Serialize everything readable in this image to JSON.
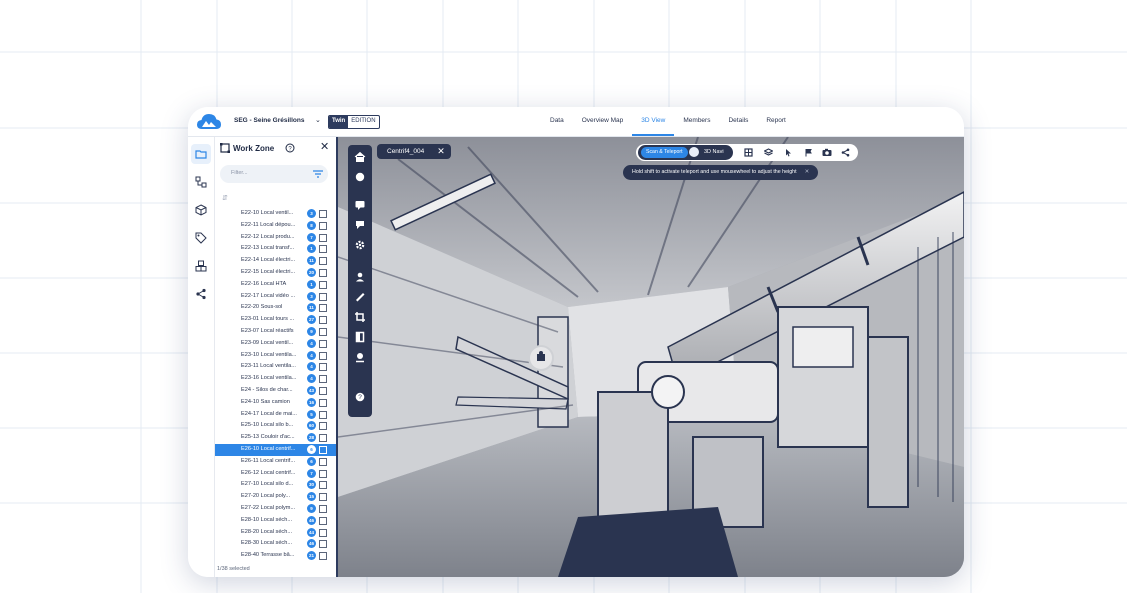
{
  "app": {
    "project_name": "SEG - Seine Grésillons",
    "edition_badge": "Twin",
    "edition_label": "EDITION",
    "colors": {
      "accent": "#2d86e6",
      "navy": "#2a3450",
      "panel_border": "#2d3b5e"
    }
  },
  "nav": {
    "tabs": [
      {
        "label": "Data",
        "active": false
      },
      {
        "label": "Overview Map",
        "active": false
      },
      {
        "label": "3D View",
        "active": true
      },
      {
        "label": "Members",
        "active": false
      },
      {
        "label": "Details",
        "active": false
      },
      {
        "label": "Report",
        "active": false
      }
    ]
  },
  "sidebar": {
    "icons": [
      "folder-icon",
      "hierarchy-icon",
      "cube-icon",
      "tag-icon",
      "cubes-icon",
      "share-icon"
    ],
    "active_index": 0
  },
  "work_zone": {
    "title": "Work Zone",
    "filter_placeholder": "Filter...",
    "items": [
      {
        "label": "E22-10 Local ventil...",
        "count": "3"
      },
      {
        "label": "E22-11 Local dépou...",
        "count": "8"
      },
      {
        "label": "E22-12 Local produ...",
        "count": "7"
      },
      {
        "label": "E22-13 Local transf...",
        "count": "1"
      },
      {
        "label": "E22-14 Local électri...",
        "count": "11"
      },
      {
        "label": "E22-15 Local électri...",
        "count": "20"
      },
      {
        "label": "E22-16 Local HTA",
        "count": "1"
      },
      {
        "label": "E22-17 Local vidéo ...",
        "count": "3"
      },
      {
        "label": "E22-20 Sous-sol",
        "count": "11"
      },
      {
        "label": "E23-01 Local tours ...",
        "count": "27"
      },
      {
        "label": "E23-07 Local réactifs",
        "count": "9"
      },
      {
        "label": "E23-09 Local ventil...",
        "count": "4"
      },
      {
        "label": "E23-10 Local ventila...",
        "count": "4"
      },
      {
        "label": "E23-11 Local ventila...",
        "count": "4"
      },
      {
        "label": "E23-16 Local ventila...",
        "count": "4"
      },
      {
        "label": "E24 - Silos de char...",
        "count": "43"
      },
      {
        "label": "E24-10 Sas camion",
        "count": "16"
      },
      {
        "label": "E24-17 Local de mai...",
        "count": "5"
      },
      {
        "label": "E25-10 Local silo b...",
        "count": "60"
      },
      {
        "label": "E25-13 Couloir d'ac...",
        "count": "28"
      },
      {
        "label": "E26-10 Local centrif...",
        "count": "6",
        "selected": true
      },
      {
        "label": "E26-11 Local centrif...",
        "count": "6"
      },
      {
        "label": "E26-12 Local centrif...",
        "count": "7"
      },
      {
        "label": "E27-10 Local silo d...",
        "count": "30"
      },
      {
        "label": "E27-20 Local poly...",
        "count": "15"
      },
      {
        "label": "E27-22 Local polym...",
        "count": "9"
      },
      {
        "label": "E28-10 Local séch...",
        "count": "46"
      },
      {
        "label": "E28-20 Local séch...",
        "count": "44"
      },
      {
        "label": "E28-30 Local séch...",
        "count": "46"
      },
      {
        "label": "E28-40 Terrasse bâ...",
        "count": "21"
      }
    ],
    "footer": "1/38 selected"
  },
  "viewer": {
    "scan_tab": "Centrif4_004",
    "mode_scan": "Scan & Teleport",
    "mode_nav": "3D Navi",
    "hint": "Hold shift to activate teleport and use mousewheel to adjust the height",
    "left_tools": [
      "home-icon",
      "sphere-icon",
      "comment-icon",
      "marker-icon",
      "gear-icon",
      "person-pin-icon",
      "ruler-icon",
      "crop-icon",
      "door-icon",
      "pin-icon",
      "help-icon"
    ],
    "top_tools": [
      "grid-icon",
      "layers-icon",
      "cursor-icon",
      "flag-icon",
      "camera-icon",
      "share-icon"
    ]
  }
}
